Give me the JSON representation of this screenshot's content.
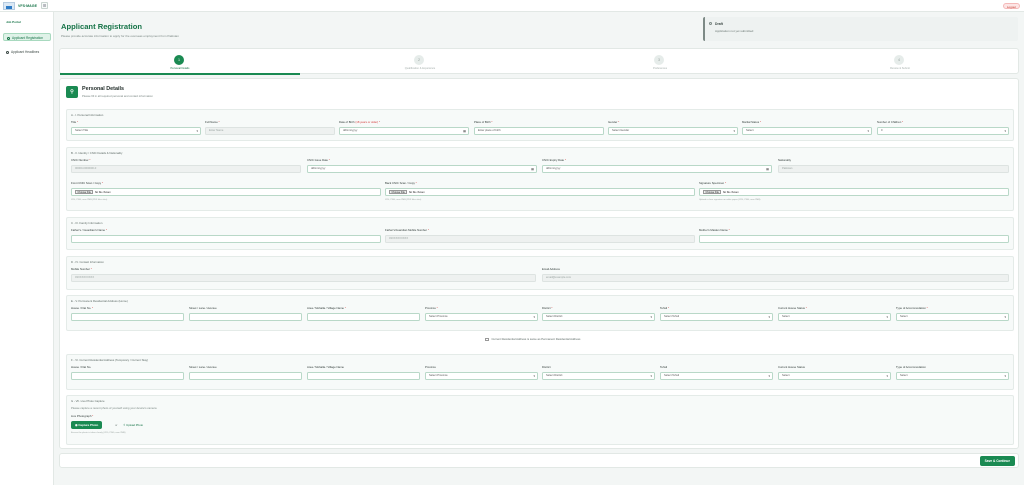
{
  "app": {
    "brand": "VFS·MAGE",
    "logout": "Logout"
  },
  "sidebar": {
    "category": "Job Portal",
    "items": [
      {
        "label": "Applicant Registration",
        "active": true
      },
      {
        "label": "Applicant Headlines",
        "active": false
      }
    ]
  },
  "header": {
    "title": "Applicant Registration",
    "subtitle": "Please provide accurate information to apply for the overseas employment from Pakistan"
  },
  "status": {
    "title": "Draft",
    "text": "Application not yet submitted"
  },
  "steps": [
    {
      "number": "1",
      "label": "Personal Details",
      "active": true
    },
    {
      "number": "2",
      "label": "Qualification & Experience",
      "active": false
    },
    {
      "number": "3",
      "label": "Preferences",
      "active": false
    },
    {
      "number": "4",
      "label": "Review & Submit",
      "active": false
    }
  ],
  "section": {
    "icon": "user-icon",
    "title": "Personal Details",
    "subtitle": "Please fill in all required personal and contact information"
  },
  "personal_info": {
    "title": "A - I. Personal Information",
    "title_label": "Title",
    "title_value": "Select Title",
    "fullname_label": "Full Name",
    "fullname_placeholder": "Enter Name",
    "dob_label": "Date of Birth",
    "dob_note": "(18 years or older)",
    "dob_placeholder": "dd/mm/yyyy",
    "pob_label": "Place of Birth",
    "pob_placeholder": "Enter place of birth",
    "gender_label": "Gender",
    "gender_value": "Select Gender",
    "marital_label": "Marital Status",
    "marital_value": "Select",
    "children_label": "Number of Children",
    "children_value": "0"
  },
  "identity": {
    "title": "B - II. Identity / CNIC Details & Nationality",
    "cnic_label": "CNIC Number",
    "cnic_value": "00000-0000000-0",
    "issue_label": "CNIC Issue Date",
    "issue_placeholder": "dd/mm/yyyy",
    "expiry_label": "CNIC Expiry Date",
    "expiry_placeholder": "dd/mm/yyyy",
    "nationality_label": "Nationality",
    "nationality_value": "Pakistan",
    "front_label": "Front CNIC Scan / Copy",
    "back_label": "Back CNIC Scan / Copy",
    "signature_label": "Signature Specimen",
    "file_button": "Choose File",
    "file_text": "No file chosen",
    "front_help": "JPG, PNG, max 2MB (PDF files also)",
    "back_help": "JPG, PNG, max 2MB (PDF files also)",
    "signature_help": "Upload a clear signature on white paper (JPG, PNG, max 2MB)"
  },
  "family": {
    "title": "C - III. Family Information",
    "father_label": "Father's / Guardian's Name",
    "father_mobile_label": "Father's/Guardian Mobile Number",
    "father_mobile_placeholder": "03XXXXXXXXX",
    "mother_label": "Mother's Maiden Name"
  },
  "contact": {
    "title": "D - IV. Contact Information",
    "mobile_label": "Mobile Number",
    "mobile_value": "03XXXXXXXXX",
    "email_label": "Email Address",
    "email_value": "email@example.com"
  },
  "permanent_address": {
    "title": "E - V. Permanent Residential Address (Home)",
    "labels": [
      "House / Flat No.",
      "Street / Lane / Avenue",
      "Area / Mohalla / Village Name",
      "Province",
      "District",
      "Tehsil",
      "Current House Status",
      "Type of Accommodation"
    ],
    "values": [
      "",
      "",
      "",
      "Select Province",
      "Select District",
      "Select Tehsil",
      "Select",
      "Select"
    ]
  },
  "same_address": {
    "label": "Current Residential Address is same as Permanent Residential Address"
  },
  "current_address": {
    "title": "F - VI. Current Residential Address (Temporary / Current Stay)",
    "labels": [
      "House / Flat No.",
      "Street / Lane / Avenue",
      "Area / Mohalla / Village Name",
      "Province",
      "District",
      "Tehsil",
      "Current House Status",
      "Type of Accommodation"
    ],
    "values": [
      "",
      "",
      "",
      "Select Province",
      "Select District",
      "Select Tehsil",
      "Select",
      "Select"
    ]
  },
  "photo": {
    "title": "G - VII. Live Photo Capture",
    "subtitle": "Please capture a recent photo of yourself using your device's camera",
    "label": "Live Photograph",
    "capture_button": "Capture Photo",
    "or_text": "or",
    "upload_button": "Upload Photo",
    "help": "Ensure the photo is taken clearly (JPG, PNG, max 2MB)"
  },
  "footer": {
    "save_button": "Save & Continue"
  },
  "colors": {
    "primary": "#1a8a52",
    "accent_light": "#dff2e8",
    "danger": "#d43b3b"
  }
}
